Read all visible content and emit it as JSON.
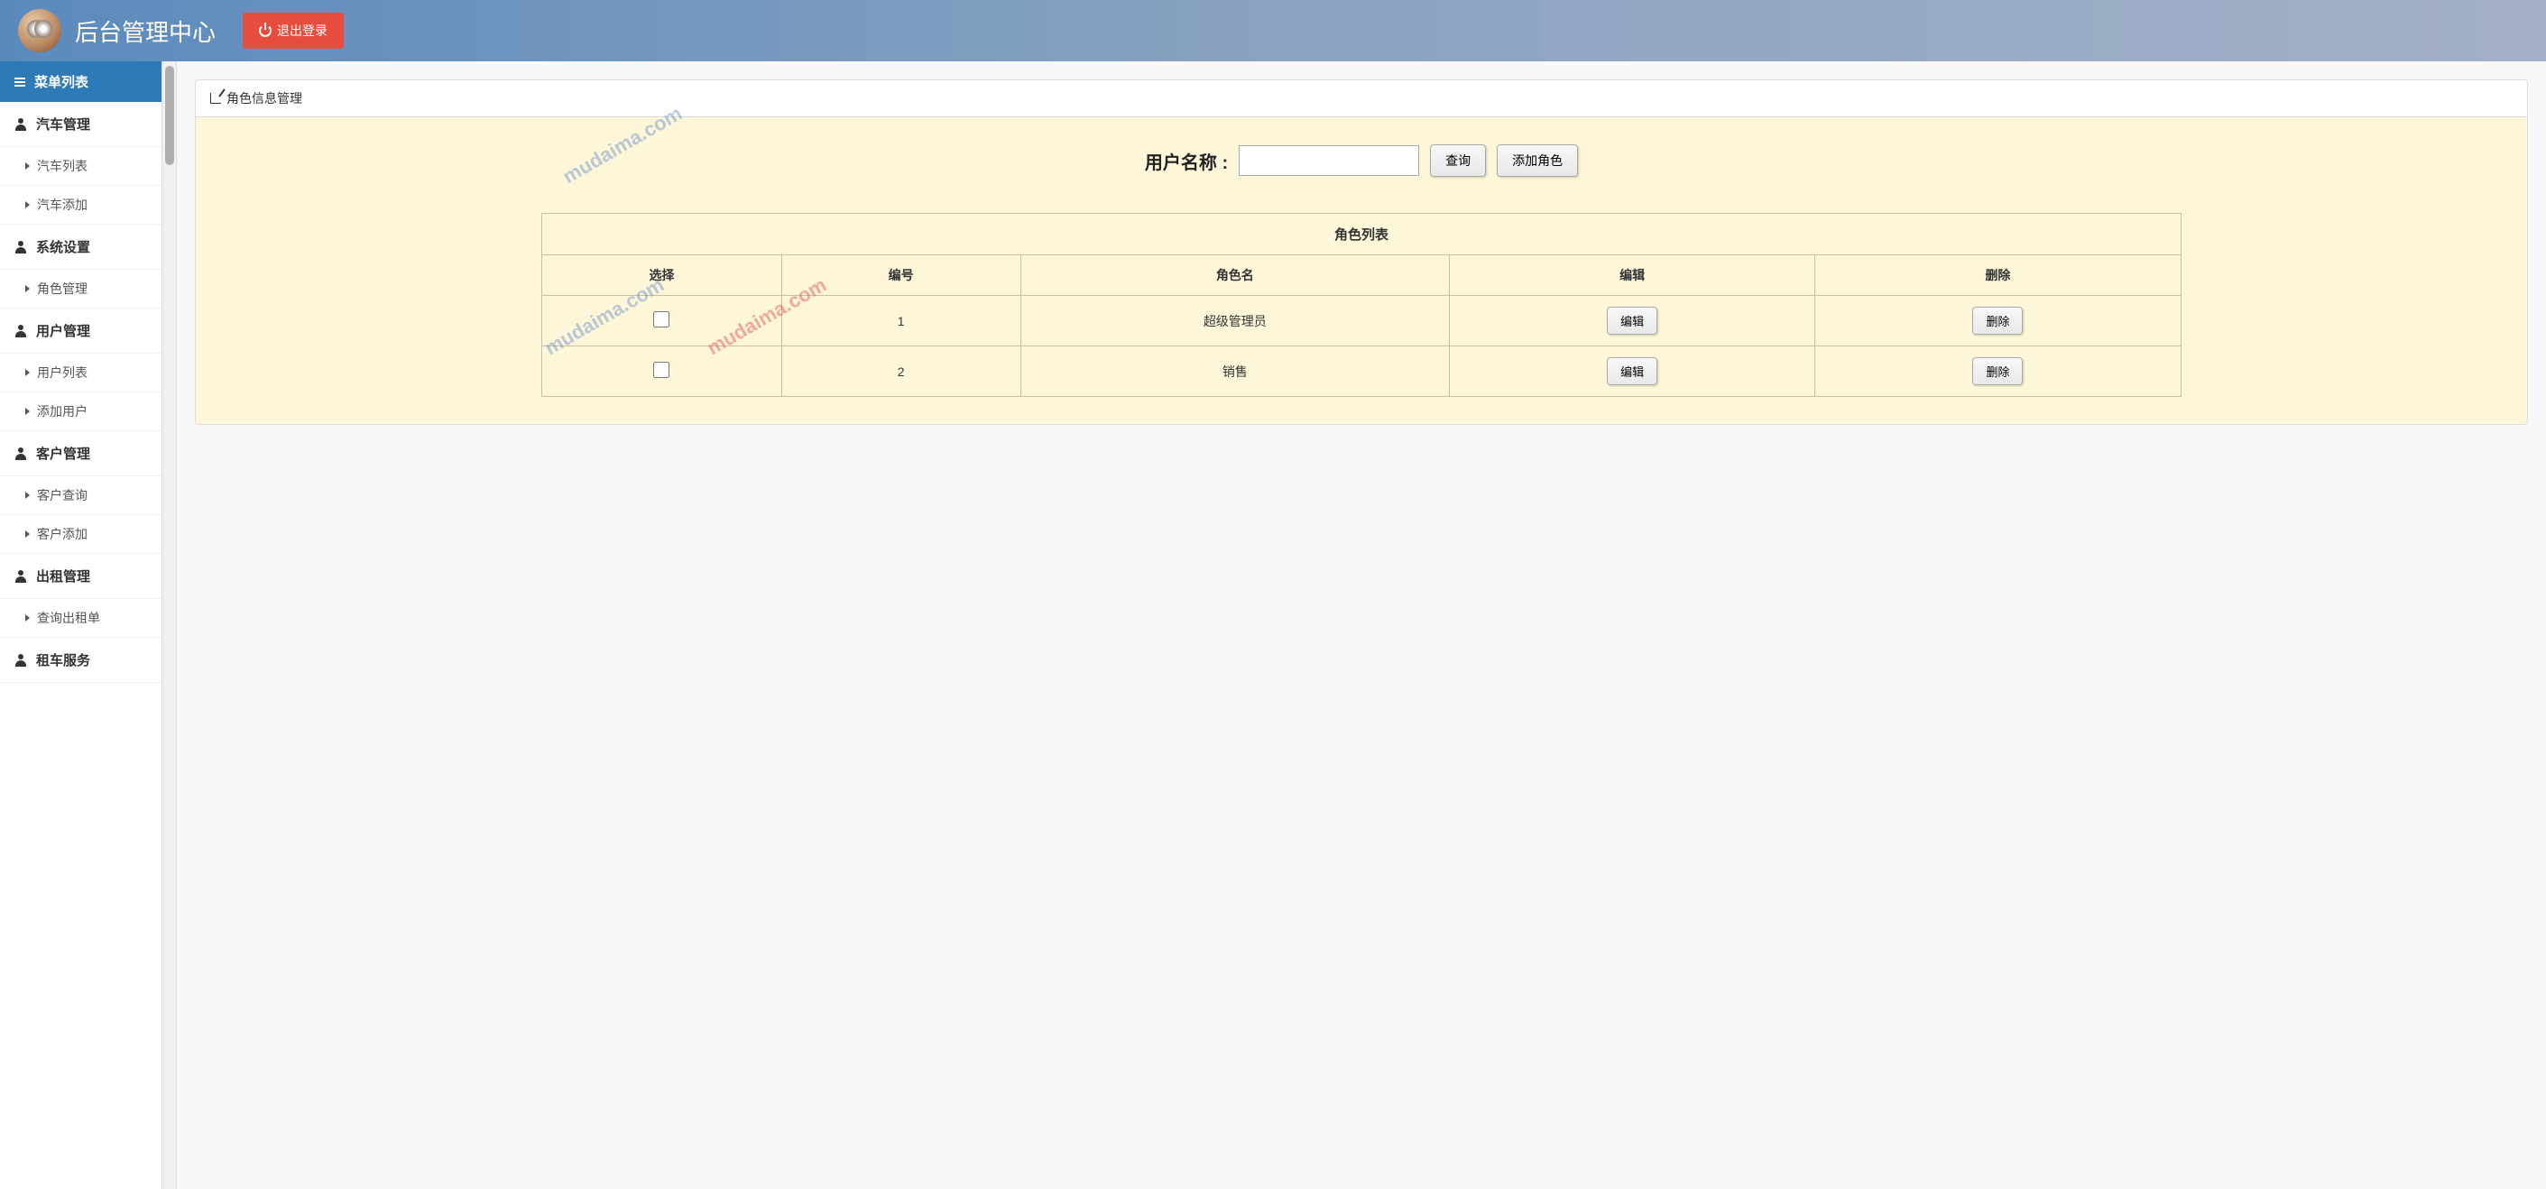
{
  "header": {
    "title": "后台管理中心",
    "logout_label": "退出登录"
  },
  "sidebar": {
    "menu_header": "菜单列表",
    "groups": [
      {
        "label": "汽车管理",
        "items": [
          {
            "label": "汽车列表"
          },
          {
            "label": "汽车添加"
          }
        ]
      },
      {
        "label": "系统设置",
        "items": [
          {
            "label": "角色管理"
          }
        ]
      },
      {
        "label": "用户管理",
        "items": [
          {
            "label": "用户列表"
          },
          {
            "label": "添加用户"
          }
        ]
      },
      {
        "label": "客户管理",
        "items": [
          {
            "label": "客户查询"
          },
          {
            "label": "客户添加"
          }
        ]
      },
      {
        "label": "出租管理",
        "items": [
          {
            "label": "查询出租单"
          }
        ]
      },
      {
        "label": "租车服务",
        "items": []
      }
    ]
  },
  "panel": {
    "title": "角色信息管理",
    "search_label": "用户名称 :",
    "search_value": "",
    "search_btn": "查询",
    "add_btn": "添加角色",
    "table_title": "角色列表",
    "columns": {
      "select": "选择",
      "id": "编号",
      "name": "角色名",
      "edit": "编辑",
      "delete": "删除"
    },
    "edit_label": "编辑",
    "delete_label": "删除",
    "rows": [
      {
        "id": "1",
        "name": "超级管理员"
      },
      {
        "id": "2",
        "name": "销售"
      }
    ]
  },
  "watermark": "mudaima.com"
}
